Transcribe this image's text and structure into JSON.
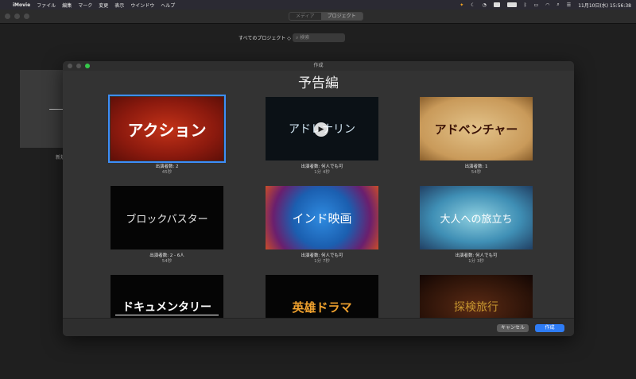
{
  "menubar": {
    "apple": "",
    "app": "iMovie",
    "items": [
      "ファイル",
      "編集",
      "マーク",
      "変更",
      "表示",
      "ウインドウ",
      "ヘルプ"
    ],
    "clock": "11月10日(水) 15:56:38"
  },
  "main": {
    "segments": [
      "メディア",
      "プロジェクト"
    ],
    "project_selector": "すべてのプロジェクト ◇",
    "search_placeholder": "検索",
    "new_label": "新規"
  },
  "dialog": {
    "title": "作成",
    "heading": "予告編",
    "tiles": [
      {
        "title": "アクション",
        "cast": "出演者数: 2",
        "duration": "45秒",
        "bg": "#9a1c10",
        "fg": "#ffffff",
        "selected": true
      },
      {
        "title": "アドレナリン",
        "cast": "出演者数: 何人でも可",
        "duration": "1分 4秒",
        "bg": "#0b1116",
        "fg": "#cfe3f0",
        "selected": false
      },
      {
        "title": "アドベンチャー",
        "cast": "出演者数: 1",
        "duration": "54秒",
        "bg": "#d8b277",
        "fg": "#3b1206",
        "selected": false
      },
      {
        "title": "ブロックバスター",
        "cast": "出演者数: 2 - 6人",
        "duration": "54秒",
        "bg": "#050505",
        "fg": "#e8e8e8",
        "selected": false
      },
      {
        "title": "インド映画",
        "cast": "出演者数: 何人でも可",
        "duration": "1分 7秒",
        "bg": "#1e73c9",
        "fg": "#ffffff",
        "selected": false
      },
      {
        "title": "大人への旅立ち",
        "cast": "出演者数: 何人でも可",
        "duration": "1分 3秒",
        "bg": "#3a82a8",
        "fg": "#ffffff",
        "selected": false
      },
      {
        "title": "ドキュメンタリー",
        "cast": "",
        "duration": "",
        "bg": "#050505",
        "fg": "#ffffff",
        "selected": false
      },
      {
        "title": "英雄ドラマ",
        "cast": "",
        "duration": "",
        "bg": "#050505",
        "fg": "#f1a22e",
        "selected": false
      },
      {
        "title": "探検旅行",
        "cast": "",
        "duration": "",
        "bg": "#2a1208",
        "fg": "#c7962f",
        "selected": false
      }
    ],
    "cancel_label": "キャンセル",
    "create_label": "作成"
  }
}
